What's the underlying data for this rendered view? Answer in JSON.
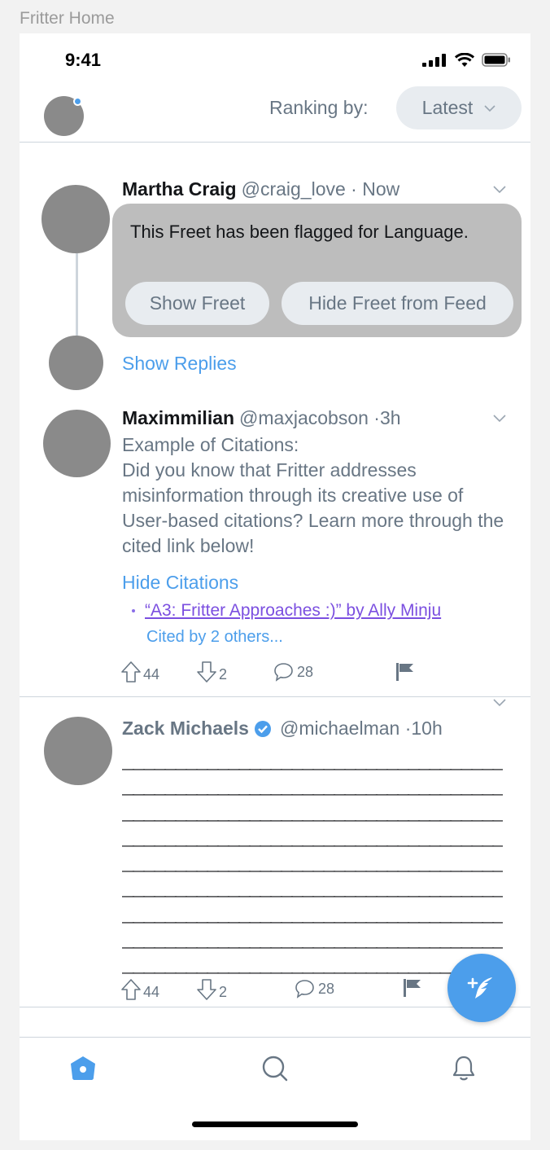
{
  "frame_label": "Fritter Home",
  "status_bar": {
    "time": "9:41"
  },
  "header": {
    "ranking_label": "Ranking by:",
    "ranking_value": "Latest"
  },
  "freets": [
    {
      "name": "Martha Craig",
      "handle": "@craig_love · Now",
      "flag_message": "This Freet has been flagged for Language.",
      "show_button": "Show Freet",
      "hide_button": "Hide Freet from Feed",
      "show_replies": "Show Replies"
    },
    {
      "name": "Maximmilian",
      "handle": "@maxjacobson ·3h",
      "body": "Example of Citations:\nDid you know that Fritter addresses misinformation through its creative use of User-based citations? Learn more through the cited link below!",
      "citations_toggle": "Hide Citations",
      "citation_link": "“A3: Fritter Approaches :)” by Ally Minju",
      "citation_sub": "Cited by 2 others...",
      "upvotes": "44",
      "downvotes": "2",
      "replies": "28"
    },
    {
      "name": "Zack Michaels",
      "handle": "@michaelman ·10h",
      "body": "______________________________________\n______________________________________\n______________________________________\n______________________________________\n______________________________________\n______________________________________\n______________________________________\n______________________________________\n______________________________________",
      "upvotes": "44",
      "downvotes": "2",
      "replies": "28"
    }
  ],
  "colors": {
    "accent": "#4c9eeb",
    "muted": "#687684",
    "divider": "#ced5dc",
    "flag_bg": "#bdbdbd"
  }
}
